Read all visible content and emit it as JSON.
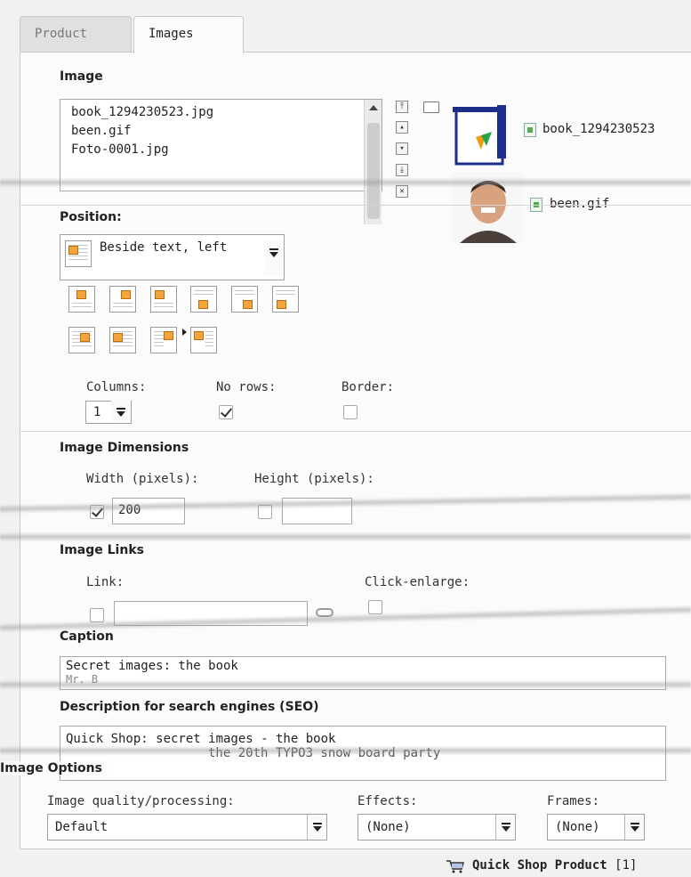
{
  "tabs": [
    {
      "label": "Product",
      "active": false
    },
    {
      "label": "Images",
      "active": true
    }
  ],
  "image_section": {
    "heading": "Image",
    "files": [
      "book_1294230523.jpg",
      "been.gif",
      "Foto-0001.jpg"
    ],
    "previews": [
      {
        "filename": "book_1294230523",
        "icon": "book-thumbnail"
      },
      {
        "filename": "been.gif",
        "icon": "portrait-thumbnail"
      }
    ]
  },
  "position": {
    "label": "Position:",
    "selected": "Beside text, left"
  },
  "layout_options": {
    "columns_label": "Columns:",
    "columns_value": "1",
    "no_rows_label": "No rows:",
    "no_rows_checked": true,
    "border_label": "Border:",
    "border_checked": false
  },
  "dimensions": {
    "heading": "Image Dimensions",
    "width_label": "Width (pixels):",
    "width_checked": true,
    "width_value": "200",
    "height_label": "Height (pixels):",
    "height_checked": false,
    "height_value": ""
  },
  "links": {
    "heading": "Image Links",
    "link_label": "Link:",
    "link_value": "",
    "click_enlarge_label": "Click-enlarge:"
  },
  "caption": {
    "heading": "Caption",
    "line1": "Secret images: the book",
    "line2": "Mr. B"
  },
  "seo": {
    "heading": "Description for search engines (SEO)",
    "line1": "Quick Shop: secret images - the book",
    "line2": "the 20th TYPO3 snow board party"
  },
  "image_options": {
    "heading": "Image Options",
    "quality_label": "Image quality/processing:",
    "quality_value": "Default",
    "effects_label": "Effects:",
    "effects_value": "(None)",
    "frames_label": "Frames:",
    "frames_value": "(None)"
  },
  "footer": {
    "record_label": "Quick Shop Product",
    "record_count": "[1]"
  },
  "colors": {
    "background": "#f1f1f1",
    "panel": "#fbfbfb",
    "accent_orange": "#f5a33b"
  }
}
